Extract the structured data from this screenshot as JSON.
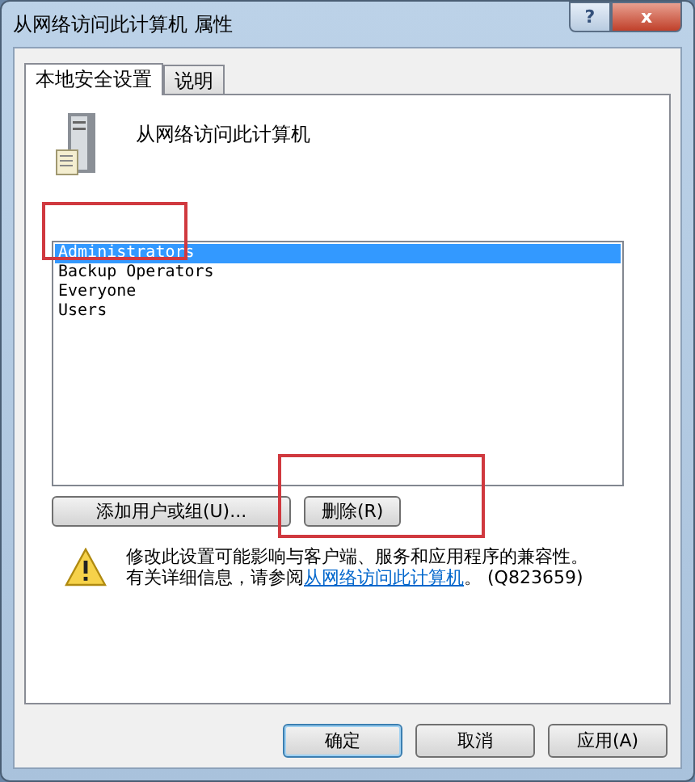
{
  "window": {
    "title": "从网络访问此计算机 属性",
    "buttons": [
      {
        "kind": "help",
        "label": "?"
      },
      {
        "kind": "close",
        "label": "x"
      }
    ]
  },
  "tabs": [
    {
      "label": "本地安全设置",
      "selected": true
    },
    {
      "label": "说明",
      "selected": false
    }
  ],
  "policy": {
    "title": "从网络访问此计算机"
  },
  "accounts": [
    {
      "name": "Administrators",
      "selected": true,
      "highlighted": true
    },
    {
      "name": "Backup Operators",
      "selected": false,
      "highlighted": false
    },
    {
      "name": "Everyone",
      "selected": false,
      "highlighted": false
    },
    {
      "name": "Users",
      "selected": false,
      "highlighted": false
    }
  ],
  "actions": [
    {
      "label": "添加用户或组(U)...",
      "highlighted": false
    },
    {
      "label": "删除(R)",
      "highlighted": true
    }
  ],
  "warning": {
    "line1": "修改此设置可能影响与客户端、服务和应用程序的兼容性。",
    "line2_before": "有关详细信息，请参阅",
    "link": "从网络访问此计算机",
    "line2_after": "。 (Q823659)"
  },
  "footer_buttons": [
    {
      "label": "确定",
      "default": true
    },
    {
      "label": "取消",
      "default": false
    },
    {
      "label": "应用(A)",
      "default": false
    }
  ]
}
